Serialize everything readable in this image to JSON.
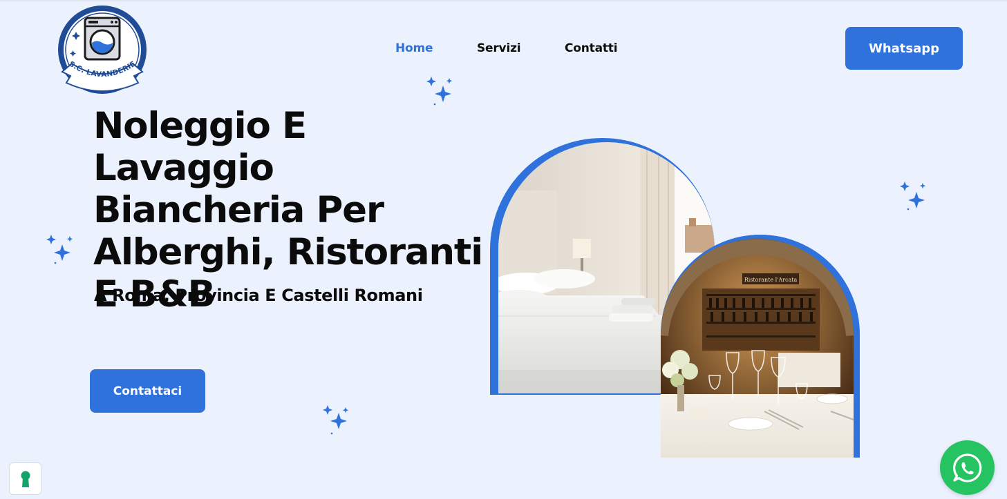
{
  "brand": {
    "logo_text": "S.C. LAVANDERIE",
    "icon": "washing-machine-logo"
  },
  "nav": {
    "items": [
      {
        "label": "Home",
        "active": true
      },
      {
        "label": "Servizi",
        "active": false
      },
      {
        "label": "Contatti",
        "active": false
      }
    ],
    "whatsapp_label": "Whatsapp"
  },
  "hero": {
    "title": "Noleggio E Lavaggio Biancheria Per Alberghi, Ristoranti E B&B",
    "subtitle": "A Roma, Provincia E Castelli Romani",
    "cta_label": "Contattaci"
  },
  "images": {
    "hotel": {
      "semantic": "hotel-bedroom-photo"
    },
    "restaurant": {
      "semantic": "restaurant-dining-photo",
      "sign_text": "Ristorante l'Arcata"
    }
  },
  "floating": {
    "whatsapp_icon": "whatsapp-icon",
    "cookie_icon": "keyhole-icon"
  },
  "colors": {
    "accent": "#2f72db",
    "background": "#ebf1fd",
    "whatsapp": "#25c361",
    "text": "#0b0b0b"
  }
}
